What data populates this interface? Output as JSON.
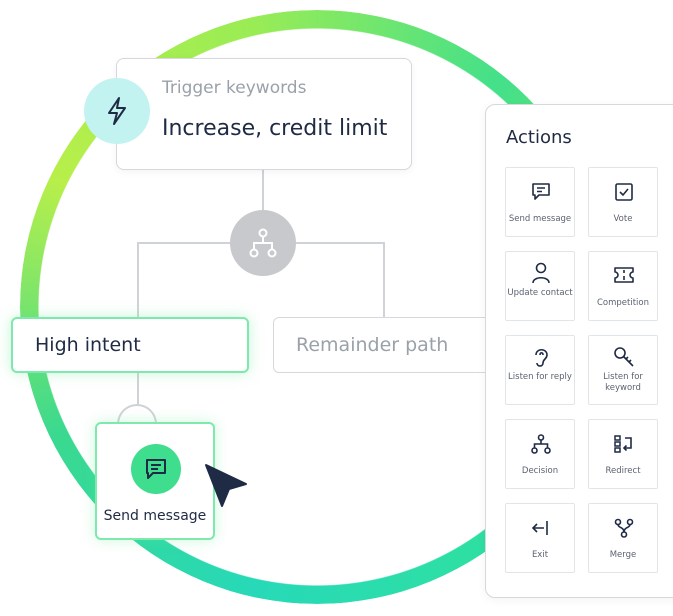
{
  "trigger": {
    "label": "Trigger keywords",
    "value": "Increase, credit limit",
    "icon": "lightning-icon"
  },
  "branch": {
    "icon": "branch-icon"
  },
  "paths": {
    "high_intent": "High intent",
    "remainder": "Remainder path"
  },
  "send_node": {
    "label": "Send message",
    "icon": "message-icon"
  },
  "actions": {
    "title": "Actions",
    "items": [
      {
        "label": "Send message",
        "icon": "message-icon"
      },
      {
        "label": "Vote",
        "icon": "checkbox-icon"
      },
      {
        "label": "Update contact",
        "icon": "person-icon"
      },
      {
        "label": "Competition",
        "icon": "ticket-icon"
      },
      {
        "label": "Listen for reply",
        "icon": "ear-icon"
      },
      {
        "label": "Listen for keyword",
        "icon": "key-icon"
      },
      {
        "label": "Decision",
        "icon": "decision-icon"
      },
      {
        "label": "Redirect",
        "icon": "redirect-icon"
      },
      {
        "label": "Exit",
        "icon": "exit-icon"
      },
      {
        "label": "Merge",
        "icon": "merge-icon"
      }
    ]
  },
  "colors": {
    "accent_green": "#3fde8e",
    "trigger_bg": "#c2f3f1",
    "text_dark": "#1f2a44",
    "text_muted": "#9aa1a9"
  }
}
